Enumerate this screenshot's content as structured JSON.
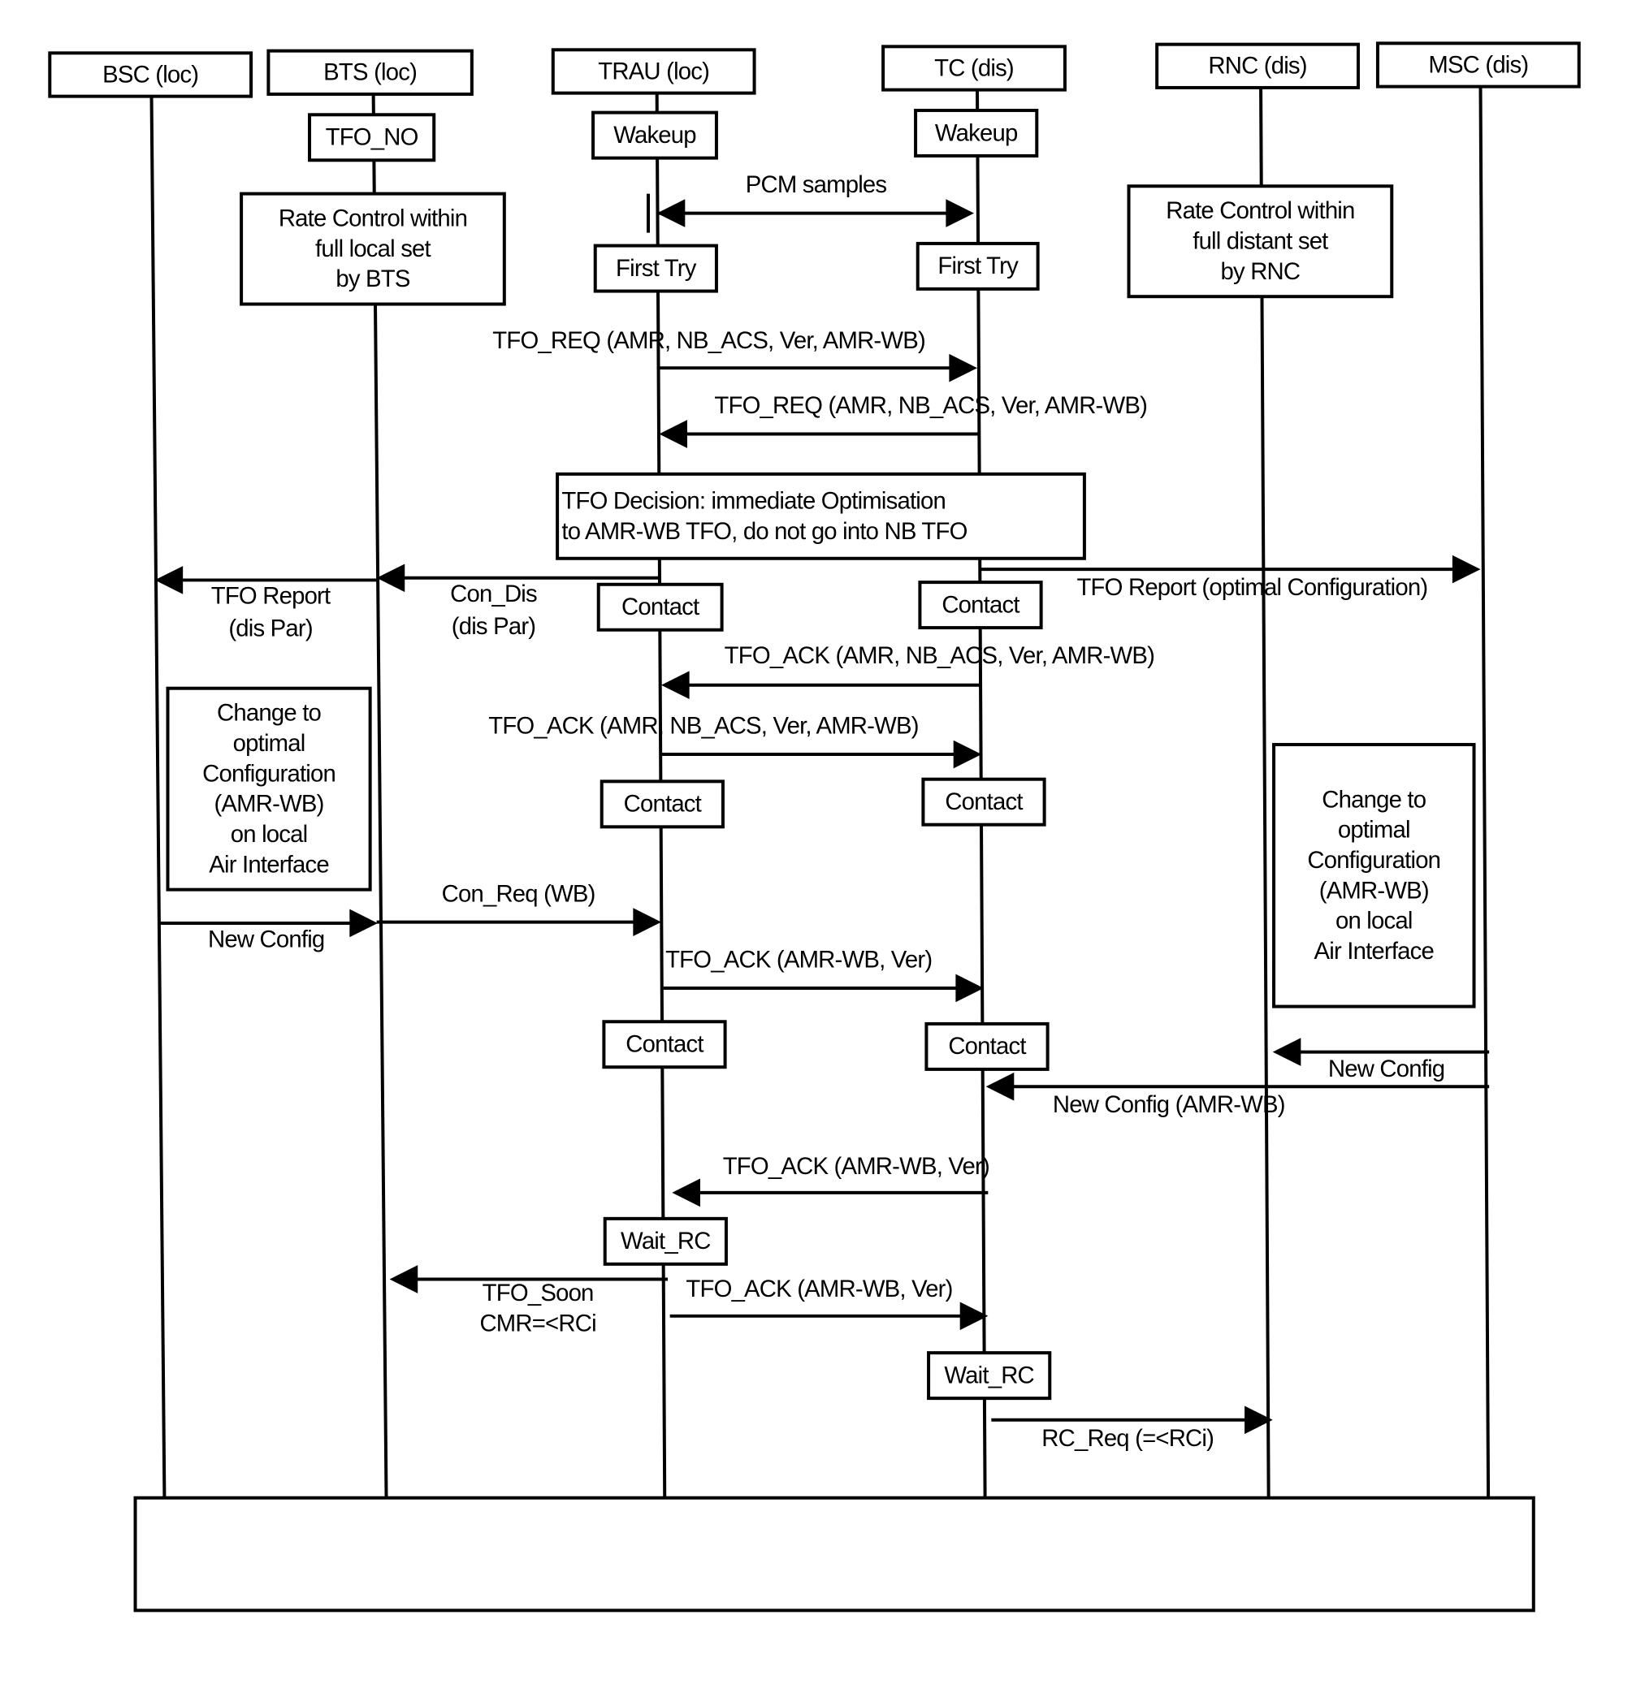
{
  "entities": [
    {
      "id": "bsc",
      "label": "BSC (loc)"
    },
    {
      "id": "bts",
      "label": "BTS (loc)"
    },
    {
      "id": "trau",
      "label": "TRAU (loc)"
    },
    {
      "id": "tc",
      "label": "TC (dis)"
    },
    {
      "id": "rnc",
      "label": "RNC (dis)"
    },
    {
      "id": "msc",
      "label": "MSC (dis)"
    }
  ],
  "states": [
    {
      "id": "bts-tfo-no",
      "lines": [
        "TFO_NO"
      ]
    },
    {
      "id": "bts-rate-control",
      "lines": [
        "Rate Control within",
        "full local set",
        "by BTS"
      ]
    },
    {
      "id": "trau-wakeup",
      "lines": [
        "Wakeup"
      ]
    },
    {
      "id": "tc-wakeup",
      "lines": [
        "Wakeup"
      ]
    },
    {
      "id": "trau-first-try",
      "lines": [
        "First Try"
      ]
    },
    {
      "id": "tc-first-try",
      "lines": [
        "First Try"
      ]
    },
    {
      "id": "rnc-rate-control",
      "lines": [
        "Rate Control within",
        "full distant set",
        "by RNC"
      ]
    },
    {
      "id": "tfo-decision",
      "lines": [
        "TFO Decision: immediate Optimisation",
        "to AMR-WB TFO, do not go into NB TFO"
      ]
    },
    {
      "id": "trau-contact-1",
      "lines": [
        "Contact"
      ]
    },
    {
      "id": "tc-contact-1",
      "lines": [
        "Contact"
      ]
    },
    {
      "id": "bsc-change-config",
      "lines": [
        "Change to",
        "optimal",
        "Configuration",
        "(AMR-WB)",
        "on local",
        "Air Interface"
      ]
    },
    {
      "id": "trau-contact-2",
      "lines": [
        "Contact"
      ]
    },
    {
      "id": "tc-contact-2",
      "lines": [
        "Contact"
      ]
    },
    {
      "id": "rnc-change-config",
      "lines": [
        "Change to",
        "optimal",
        "Configuration",
        "(AMR-WB)",
        "on local",
        "Air Interface"
      ]
    },
    {
      "id": "trau-contact-3",
      "lines": [
        "Contact"
      ]
    },
    {
      "id": "tc-contact-3",
      "lines": [
        "Contact"
      ]
    },
    {
      "id": "trau-wait-rc",
      "lines": [
        "Wait_RC"
      ]
    },
    {
      "id": "tc-wait-rc",
      "lines": [
        "Wait_RC"
      ]
    }
  ],
  "messages": [
    {
      "id": "pcm-samples",
      "from": "trau",
      "to": "tc",
      "bidirectional": true,
      "lines": [
        "PCM samples"
      ]
    },
    {
      "id": "tfo-req-1",
      "from": "trau",
      "to": "tc",
      "lines": [
        "TFO_REQ (AMR, NB_ACS, Ver, AMR-WB)"
      ]
    },
    {
      "id": "tfo-req-2",
      "from": "tc",
      "to": "trau",
      "lines": [
        "TFO_REQ (AMR, NB_ACS, Ver, AMR-WB)"
      ]
    },
    {
      "id": "tfo-report-dis-par",
      "from": "bts",
      "to": "bsc",
      "lines": [
        "TFO Report",
        "(dis Par)"
      ]
    },
    {
      "id": "con-dis",
      "from": "trau",
      "to": "bts",
      "lines": [
        "Con_Dis",
        "(dis Par)"
      ]
    },
    {
      "id": "tfo-report-optimal",
      "from": "tc",
      "to": "msc",
      "lines": [
        "TFO Report (optimal Configuration)"
      ]
    },
    {
      "id": "tfo-ack-1",
      "from": "tc",
      "to": "trau",
      "lines": [
        "TFO_ACK (AMR, NB_ACS, Ver, AMR-WB)"
      ]
    },
    {
      "id": "tfo-ack-2",
      "from": "trau",
      "to": "tc",
      "lines": [
        "TFO_ACK (AMR, NB_ACS, Ver, AMR-WB)"
      ]
    },
    {
      "id": "con-req-wb",
      "from": "bts",
      "to": "trau",
      "lines": [
        "Con_Req (WB)"
      ]
    },
    {
      "id": "new-config-local",
      "from": "bsc",
      "to": "bts",
      "lines": [
        "New Config"
      ]
    },
    {
      "id": "tfo-ack-3",
      "from": "trau",
      "to": "tc",
      "lines": [
        "TFO_ACK (AMR-WB, Ver)"
      ]
    },
    {
      "id": "new-config-distant",
      "from": "msc",
      "to": "rnc",
      "lines": [
        "New Config"
      ]
    },
    {
      "id": "new-config-amr-wb",
      "from": "msc",
      "to": "tc",
      "lines": [
        "New Config (AMR-WB)"
      ]
    },
    {
      "id": "tfo-ack-4",
      "from": "tc",
      "to": "trau",
      "lines": [
        "TFO_ACK (AMR-WB, Ver)"
      ]
    },
    {
      "id": "tfo-soon",
      "from": "trau",
      "to": "bts",
      "lines": [
        "TFO_Soon",
        "CMR=<RCi"
      ]
    },
    {
      "id": "tfo-ack-5",
      "from": "trau",
      "to": "tc",
      "lines": [
        "TFO_ACK (AMR-WB, Ver)"
      ]
    },
    {
      "id": "rc-req",
      "from": "tc",
      "to": "rnc",
      "lines": [
        "RC_Req (=<RCi)"
      ]
    }
  ],
  "footer_box": {
    "lines": []
  }
}
